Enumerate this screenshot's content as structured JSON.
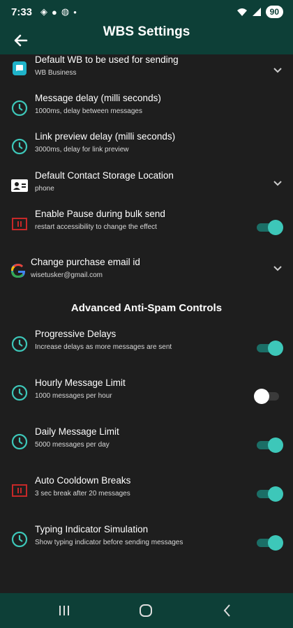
{
  "status_bar": {
    "time": "7:33",
    "battery": "90"
  },
  "app_bar": {
    "title": "WBS Settings"
  },
  "settings": [
    {
      "title": "Default WB to be used for sending",
      "subtitle": "WB Business"
    },
    {
      "title": "Message delay (milli seconds)",
      "subtitle": "1000ms, delay between messages"
    },
    {
      "title": "Link preview delay (milli seconds)",
      "subtitle": "3000ms, delay for link preview"
    },
    {
      "title": "Default Contact Storage Location",
      "subtitle": "phone"
    },
    {
      "title": "Enable Pause during bulk send",
      "subtitle": "restart accessibility to change the effect",
      "enabled": true
    },
    {
      "title": "Change purchase email id",
      "subtitle": "wisetusker@gmail.com"
    }
  ],
  "section_header": "Advanced Anti-Spam Controls",
  "advanced": [
    {
      "title": "Progressive Delays",
      "subtitle": "Increase delays as more messages are sent",
      "enabled": true
    },
    {
      "title": "Hourly Message Limit",
      "subtitle": "1000 messages per hour",
      "enabled": false
    },
    {
      "title": "Daily Message Limit",
      "subtitle": "5000 messages per day",
      "enabled": true
    },
    {
      "title": "Auto Cooldown Breaks",
      "subtitle": "3 sec break after 20 messages",
      "enabled": true
    },
    {
      "title": "Typing Indicator Simulation",
      "subtitle": "Show typing indicator before sending messages",
      "enabled": true
    }
  ],
  "colors": {
    "accent": "#3dc7b9",
    "bar": "#0d3f37",
    "background": "#1e1e1e",
    "pause_icon": "#c62828"
  }
}
